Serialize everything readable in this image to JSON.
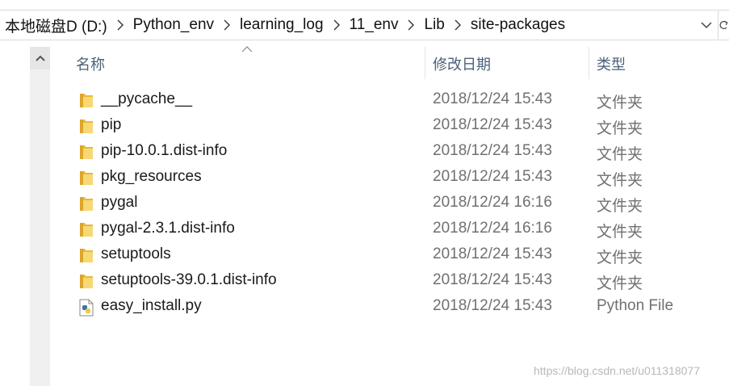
{
  "address": {
    "breadcrumbs": [
      "本地磁盘D (D:)",
      "Python_env",
      "learning_log",
      "11_env",
      "Lib",
      "site-packages"
    ]
  },
  "columns": {
    "name": "名称",
    "date": "修改日期",
    "type": "类型"
  },
  "files": [
    {
      "name": "__pycache__",
      "date": "2018/12/24 15:43",
      "type": "文件夹",
      "icon": "folder-icon"
    },
    {
      "name": "pip",
      "date": "2018/12/24 15:43",
      "type": "文件夹",
      "icon": "folder-icon"
    },
    {
      "name": "pip-10.0.1.dist-info",
      "date": "2018/12/24 15:43",
      "type": "文件夹",
      "icon": "folder-icon"
    },
    {
      "name": "pkg_resources",
      "date": "2018/12/24 15:43",
      "type": "文件夹",
      "icon": "folder-icon"
    },
    {
      "name": "pygal",
      "date": "2018/12/24 16:16",
      "type": "文件夹",
      "icon": "folder-icon"
    },
    {
      "name": "pygal-2.3.1.dist-info",
      "date": "2018/12/24 16:16",
      "type": "文件夹",
      "icon": "folder-icon"
    },
    {
      "name": "setuptools",
      "date": "2018/12/24 15:43",
      "type": "文件夹",
      "icon": "folder-icon"
    },
    {
      "name": "setuptools-39.0.1.dist-info",
      "date": "2018/12/24 15:43",
      "type": "文件夹",
      "icon": "folder-icon"
    },
    {
      "name": "easy_install.py",
      "date": "2018/12/24 15:43",
      "type": "Python File",
      "icon": "python-file-icon"
    }
  ],
  "watermark": "https://blog.csdn.net/u011318077",
  "colors": {
    "folder": "#f8d775",
    "header_text": "#4c607a",
    "secondary_text": "#707070"
  }
}
